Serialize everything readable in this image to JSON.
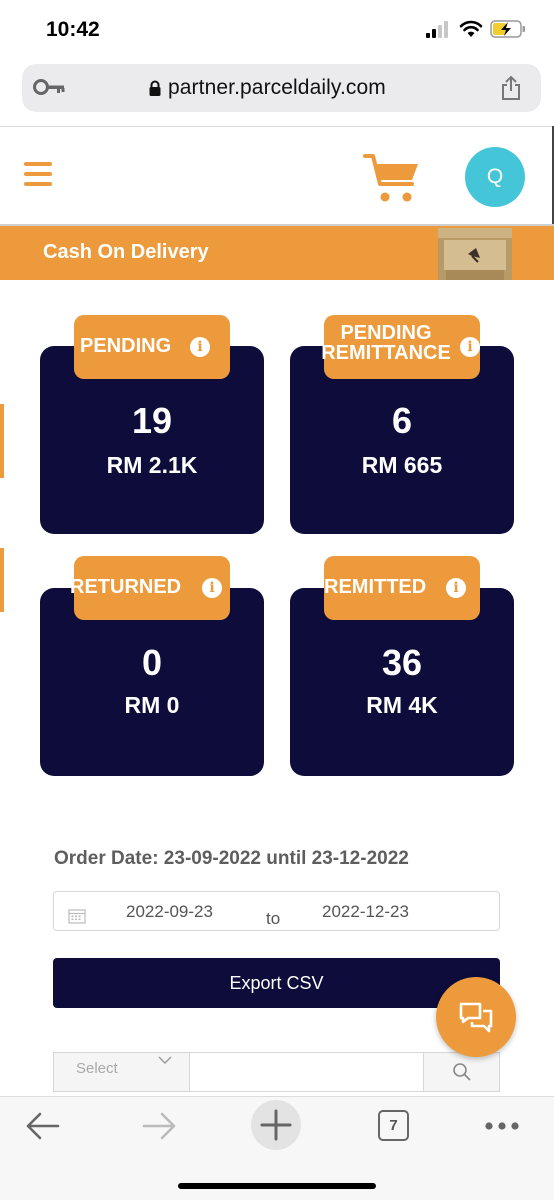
{
  "status_bar": {
    "time": "10:42"
  },
  "browser": {
    "url": "partner.parceldaily.com",
    "tab_count": "7"
  },
  "header": {
    "avatar_initial": "Q"
  },
  "banner": {
    "title": "Cash On Delivery"
  },
  "cards": [
    {
      "label": "PENDING",
      "count": "19",
      "amount": "RM 2.1K"
    },
    {
      "label_line1": "PENDING",
      "label_line2": "REMITTANCE",
      "count": "6",
      "amount": "RM 665"
    },
    {
      "label": "RETURNED",
      "count": "0",
      "amount": "RM 0"
    },
    {
      "label": "REMITTED",
      "count": "36",
      "amount": "RM 4K"
    }
  ],
  "filters": {
    "order_date_text": "Order Date: 23-09-2022 until 23-12-2022",
    "date_from": "2022-09-23",
    "date_to_label": "to",
    "date_until": "2022-12-23",
    "export_label": "Export CSV",
    "select_placeholder": "Select"
  },
  "colors": {
    "accent": "#ec9a3b",
    "navy": "#0d0c3b",
    "avatar": "#45c6d8"
  }
}
